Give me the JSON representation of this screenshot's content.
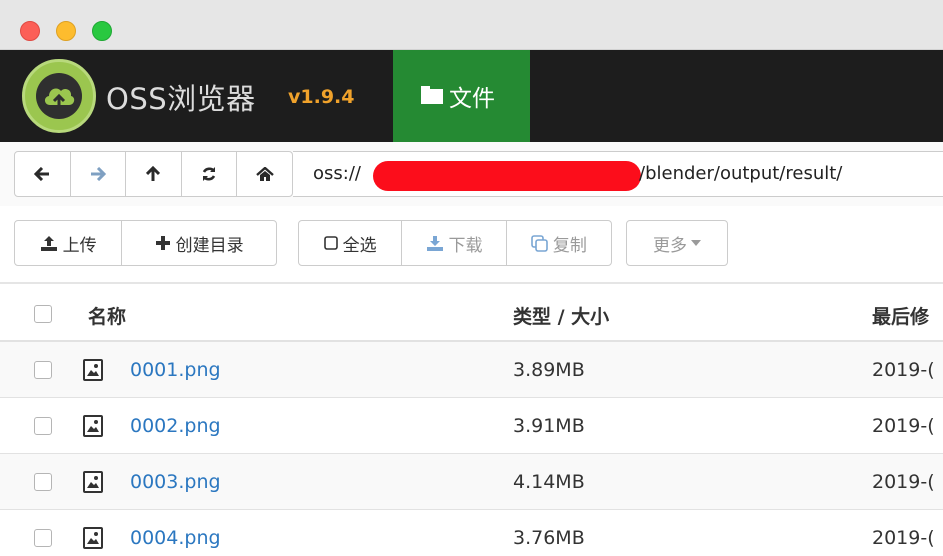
{
  "window": {
    "traffic_lights": [
      "close",
      "minimize",
      "maximize"
    ]
  },
  "app": {
    "brand": "OSS浏览器",
    "version": "v1.9.4",
    "active_tab": {
      "icon": "folder-icon",
      "label": "文件"
    }
  },
  "nav": {
    "buttons": [
      {
        "name": "back",
        "icon": "arrow-left-icon",
        "glyph": "🡐"
      },
      {
        "name": "forward",
        "icon": "arrow-right-icon",
        "glyph": "🡒"
      },
      {
        "name": "up",
        "icon": "arrow-up-icon",
        "glyph": "🡑"
      },
      {
        "name": "refresh",
        "icon": "refresh-icon",
        "glyph": "⟳"
      },
      {
        "name": "home",
        "icon": "home-icon",
        "glyph": "⌂"
      }
    ],
    "path_prefix": "oss://",
    "path_suffix": "/blender/output/result/"
  },
  "toolbar": {
    "upload": {
      "icon": "upload-icon",
      "label": "上传"
    },
    "mkdir": {
      "icon": "plus-icon",
      "label": "创建目录"
    },
    "select_all": {
      "icon": "checkbox-icon",
      "label": "全选"
    },
    "download": {
      "icon": "download-icon",
      "label": "下载"
    },
    "copy": {
      "icon": "copy-icon",
      "label": "复制"
    },
    "more": {
      "label": "更多",
      "icon": "caret-down-icon"
    }
  },
  "table": {
    "headers": {
      "name": "名称",
      "type_size": "类型 / 大小",
      "modified": "最后修"
    },
    "rows": [
      {
        "name": "0001.png",
        "size": "3.89MB",
        "modified": "2019-("
      },
      {
        "name": "0002.png",
        "size": "3.91MB",
        "modified": "2019-("
      },
      {
        "name": "0003.png",
        "size": "4.14MB",
        "modified": "2019-("
      },
      {
        "name": "0004.png",
        "size": "3.76MB",
        "modified": "2019-("
      }
    ]
  },
  "colors": {
    "header_bg": "#1d1d1d",
    "active_tab": "#258a33",
    "version": "#f0a22b",
    "link": "#2b77c0",
    "redaction": "#fc0d1b"
  }
}
